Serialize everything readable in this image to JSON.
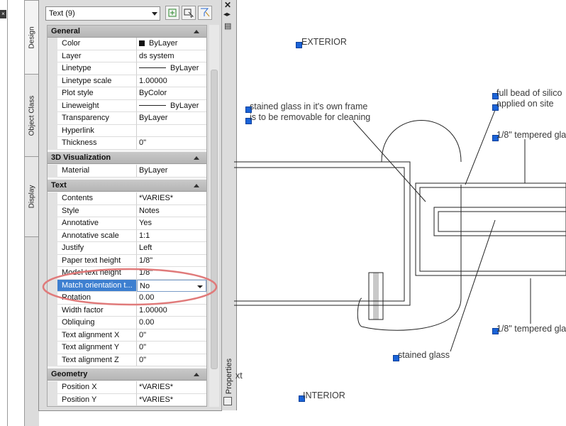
{
  "selection": {
    "dropdown_value": "Text (9)"
  },
  "side_tabs": [
    "Design",
    "Object Class",
    "Display"
  ],
  "palette_title": "Properties",
  "categories": {
    "general": "General",
    "visualization": "3D Visualization",
    "text": "Text",
    "geometry": "Geometry"
  },
  "rows": {
    "color": [
      "Color",
      "ByLayer"
    ],
    "layer": [
      "Layer",
      "ds system"
    ],
    "linetype": [
      "Linetype",
      "ByLayer"
    ],
    "linetype_scale": [
      "Linetype scale",
      "1.00000"
    ],
    "plot_style": [
      "Plot style",
      "ByColor"
    ],
    "lineweight": [
      "Lineweight",
      "ByLayer"
    ],
    "transparency": [
      "Transparency",
      "ByLayer"
    ],
    "hyperlink": [
      "Hyperlink",
      ""
    ],
    "thickness": [
      "Thickness",
      "0\""
    ],
    "material": [
      "Material",
      "ByLayer"
    ],
    "contents": [
      "Contents",
      "*VARIES*"
    ],
    "style": [
      "Style",
      "Notes"
    ],
    "annotative": [
      "Annotative",
      "Yes"
    ],
    "annotative_scale": [
      "Annotative scale",
      "1:1"
    ],
    "justify": [
      "Justify",
      "Left"
    ],
    "paper_text_height": [
      "Paper text height",
      "1/8\""
    ],
    "model_text_height": [
      "Model text height",
      "1/8\""
    ],
    "match_orientation": [
      "Match orientation t...",
      "No"
    ],
    "rotation": [
      "Rotation",
      "0.00"
    ],
    "width_factor": [
      "Width factor",
      "1.00000"
    ],
    "obliquing": [
      "Obliquing",
      "0.00"
    ],
    "text_align_x": [
      "Text alignment X",
      "0\""
    ],
    "text_align_y": [
      "Text alignment Y",
      "0\""
    ],
    "text_align_z": [
      "Text alignment Z",
      "0\""
    ],
    "position_x": [
      "Position X",
      "*VARIES*"
    ],
    "position_y": [
      "Position Y",
      "*VARIES*"
    ]
  },
  "drawing": {
    "exterior": "EXTERIOR",
    "interior": "INTERIOR",
    "stained_line1": "stained glass in it's own frame",
    "stained_line2": "is to be removable for cleaning",
    "bead_line1": "full bead of silico",
    "bead_line2": "applied on site",
    "tempered_top": "1/8\" tempered glas",
    "tempered_bottom": "1/8\" tempered gla",
    "stained_glass": "stained glass",
    "text_fragment": "xt"
  },
  "colors": {
    "highlight": "#3d7fd0",
    "grip": "#1a63d8",
    "annotation_ellipse": "#e07a7a"
  }
}
